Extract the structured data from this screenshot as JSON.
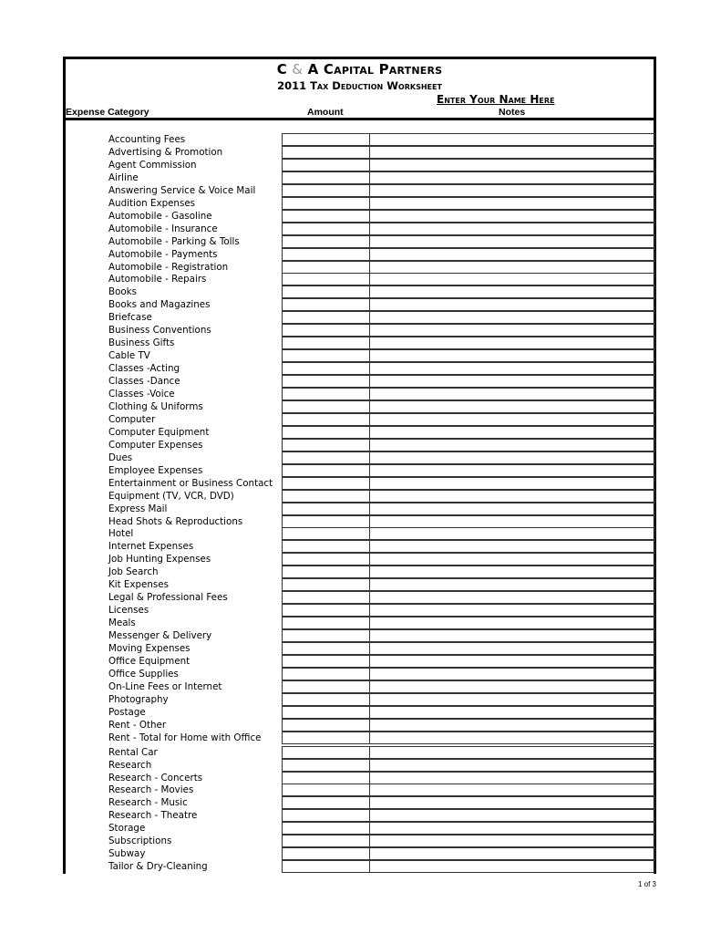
{
  "header": {
    "company_part1": "C ",
    "company_amp": "&",
    "company_part2": " A Capital Partners",
    "subtitle": "2011 Tax Deduction Worksheet",
    "name_placeholder": "Enter Your Name Here"
  },
  "columns": {
    "category": "Expense Category",
    "amount": "Amount",
    "notes": "Notes"
  },
  "rows": [
    "Accounting Fees",
    "Advertising & Promotion",
    "Agent Commission",
    "Airline",
    "Answering Service & Voice Mail",
    "Audition Expenses",
    "Automobile - Gasoline",
    "Automobile - Insurance",
    "Automobile - Parking & Tolls",
    "Automobile - Payments",
    "Automobile - Registration",
    "Automobile - Repairs",
    "Books",
    "Books and Magazines",
    "Briefcase",
    "Business Conventions",
    "Business Gifts",
    "Cable TV",
    "Classes -Acting",
    "Classes -Dance",
    "Classes -Voice",
    "Clothing & Uniforms",
    "Computer",
    "Computer Equipment",
    "Computer Expenses",
    "Dues",
    "Employee Expenses",
    "Entertainment or Business Contact",
    "Equipment (TV, VCR, DVD)",
    "Express Mail",
    "Head Shots & Reproductions",
    "Hotel",
    "Internet Expenses",
    "Job Hunting Expenses",
    "Job Search",
    "Kit Expenses",
    "Legal & Professional Fees",
    "Licenses",
    "Meals",
    "Messenger & Delivery",
    "Moving Expenses",
    "Office Equipment",
    "Office Supplies",
    "On-Line Fees or Internet",
    "Photography",
    "Postage",
    "Rent - Other",
    "Rent - Total for Home with Office",
    "Rental Car",
    "Research",
    "Research - Concerts",
    "Research - Movies",
    "Research - Music",
    "Research - Theatre",
    "Storage",
    "Subscriptions",
    "Subway",
    "Tailor & Dry-Cleaning"
  ],
  "footer": {
    "page": "1 of 3"
  }
}
